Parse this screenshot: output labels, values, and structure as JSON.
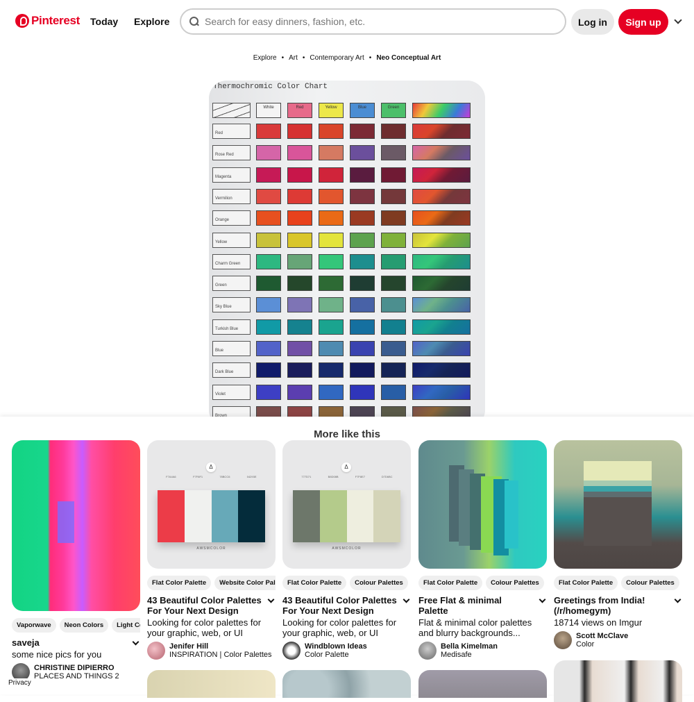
{
  "header": {
    "logo_text": "Pinterest",
    "nav": [
      "Today",
      "Explore"
    ],
    "search_placeholder": "Search for easy dinners, fashion, etc.",
    "login_label": "Log in",
    "signup_label": "Sign up",
    "colors": {
      "brand": "#e60023"
    }
  },
  "breadcrumb": [
    "Explore",
    "Art",
    "Contemporary Art",
    "Neo Conceptual Art"
  ],
  "main_pin": {
    "chart_title": "Thermochromic Color Chart",
    "header_labels": [
      "White",
      "Red",
      "Yellow",
      "Blue",
      "Green"
    ],
    "rows": [
      {
        "label": "Red",
        "colors": [
          "#d93a3a",
          "#d63232",
          "#d9452a",
          "#7c2a35",
          "#6e2d2f"
        ]
      },
      {
        "label": "Rose Red",
        "colors": [
          "#d565a8",
          "#d9559a",
          "#d57a62",
          "#6b4f9c",
          "#6b5a66"
        ]
      },
      {
        "label": "Magenta",
        "colors": [
          "#c61a56",
          "#c8164a",
          "#d0243a",
          "#5a1c3f",
          "#701a34"
        ]
      },
      {
        "label": "Vermilion",
        "colors": [
          "#e04a42",
          "#dd3a35",
          "#e2562e",
          "#7d3440",
          "#74383a"
        ]
      },
      {
        "label": "Orange",
        "colors": [
          "#e7501f",
          "#e8421c",
          "#ea6a16",
          "#9a3a22",
          "#7f3b21"
        ]
      },
      {
        "label": "Yellow",
        "colors": [
          "#c8c23a",
          "#d9c62a",
          "#e3e43c",
          "#5da24e",
          "#7fb13a"
        ]
      },
      {
        "label": "Charm Green",
        "colors": [
          "#2db881",
          "#67a577",
          "#34c67a",
          "#1d8e8e",
          "#269c71"
        ]
      },
      {
        "label": "Green",
        "colors": [
          "#1f5a31",
          "#25472b",
          "#2d6a34",
          "#1f3d33",
          "#25452d"
        ]
      },
      {
        "label": "Sky Blue",
        "colors": [
          "#5b8fd6",
          "#7e74b5",
          "#6fb289",
          "#4862a7",
          "#4c8f8f"
        ]
      },
      {
        "label": "Turkish Blue",
        "colors": [
          "#119aa6",
          "#15828f",
          "#1aa48f",
          "#1570a0",
          "#12808f"
        ]
      },
      {
        "label": "Blue",
        "colors": [
          "#5263c9",
          "#7150a6",
          "#4e8bb1",
          "#3a43b0",
          "#3a5c8f"
        ]
      },
      {
        "label": "Dark Blue",
        "colors": [
          "#101b6b",
          "#1a1d5c",
          "#172a6c",
          "#121a5d",
          "#152456"
        ]
      },
      {
        "label": "Violet",
        "colors": [
          "#3d3fc4",
          "#5b3eb0",
          "#3168c1",
          "#2f35ba",
          "#285ea6"
        ]
      },
      {
        "label": "Brown",
        "colors": [
          "#7a4c4a",
          "#8c4444",
          "#8a6438",
          "#4d4453",
          "#5a5a48"
        ]
      }
    ]
  },
  "more": {
    "title": "More like this",
    "cards": [
      {
        "chips": [
          "Vaporwave",
          "Neon Colors",
          "Light Colors"
        ],
        "title": "saveja",
        "desc": "some nice pics for you",
        "author": "CHRISTINE DIPIERRO",
        "board": "PLACES AND THINGS 2"
      },
      {
        "chips": [
          "Flat Color Palette",
          "Website Color Palette"
        ],
        "title": "43 Beautiful Color Palettes For Your Next Design",
        "desc": "Looking for color palettes for your graphic, web, or UI design...",
        "author": "Jenifer Hill",
        "board": "INSPIRATION | Color Palettes",
        "palette": [
          "#ec3c48",
          "#f0f1ef",
          "#67a9b8",
          "#042c3b"
        ],
        "codes": [
          "F7A4A6",
          "F7F8F1",
          "78BCC6",
          "04293E"
        ],
        "logo": "Δ",
        "brand": "AWSMCOLOR"
      },
      {
        "chips": [
          "Flat Color Palette",
          "Colour Palettes"
        ],
        "title": "43 Beautiful Color Palettes For Your Next Design",
        "desc": "Looking for color palettes for your graphic, web, or UI design...",
        "author": "Windblown Ideas",
        "board": "Color Palette",
        "palette": [
          "#6d776a",
          "#b4cb8b",
          "#eeeedf",
          "#d4d4b8"
        ],
        "codes": [
          "777D71",
          "B8D08B",
          "F7F8E7",
          "D7D6BC"
        ],
        "logo": "Δ",
        "brand": "AWSMCOLOR"
      },
      {
        "chips": [
          "Flat Color Palette",
          "Colour Palettes"
        ],
        "title": "Free Flat & minimal Palette",
        "desc": "Flat & minimal color palettes and blurry backgrounds...",
        "author": "Bella Kimelman",
        "board": "Medisafe"
      },
      {
        "chips": [
          "Flat Color Palette",
          "Colour Palettes"
        ],
        "title": "Greetings from India! (/r/homegym)",
        "desc": "18714 views on Imgur",
        "author": "Scott McClave",
        "board": "Color"
      }
    ]
  },
  "footer": {
    "privacy": "Privacy"
  }
}
